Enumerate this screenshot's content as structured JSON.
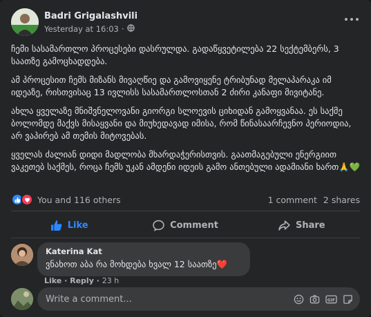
{
  "post": {
    "author": "Badri Grigalashvili",
    "time": "Yesterday at 16:03",
    "paragraphs": [
      "ჩემი სასამართლო პროცესები დასრულდა. გადაწყვეტილება 22 სექტემბერს, 3 საათზე გამოცხადდება.",
      "ამ პროცესით ჩემს მიზანს მივაღწიე და გამოვიყენე ტრიბუნად მელაპარაკა იმ იდეაზე, რისთვისაც 13 ივლისს სასამართლოსთან 2 ძირი კანაფი მივიტანე.",
      "ახლა ყველაზე მნიშვნელოვანი გიორგი სლოევის ციხიდან გამოყვანაა. ეს საქმე ბოლომდე მაქვს მისაყვანი და მიუხედავად იმისა, რომ წინასაარჩევნო პერიოდია, არ ვაპირებ ამ თემის მიტოვებას.",
      "ყველას ძალიან დიდი მადლობა  მხარდაჭერისთვის. გაათმაგებული ენერგიით ვაკეთებ საქმეს, როცა ჩემს უკან ამდენი იდეის გამო ანთებული ადამიანი ხართ🙏💚"
    ]
  },
  "reactions": {
    "summary": "You and 116 others",
    "comments": "1 comment",
    "shares": "2 shares"
  },
  "actions": {
    "like": "Like",
    "comment": "Comment",
    "share": "Share"
  },
  "comment": {
    "author": "Katerina Kat",
    "text": "ვნახოთ აბა რა მოხდება ხვალ 12 საათზე❤️",
    "like": "Like",
    "reply": "Reply",
    "time": "23 h"
  },
  "composer": {
    "placeholder": "Write a comment..."
  },
  "icons": {
    "public": "globe-icon",
    "more": "more-icon",
    "like_reaction": "like-reaction-icon",
    "love_reaction": "love-reaction-icon",
    "emoji": "emoji-icon",
    "camera": "camera-icon",
    "gif": "gif-icon",
    "sticker": "sticker-icon"
  },
  "colors": {
    "background": "#242526",
    "accent": "#2d88ff",
    "love": "#f33e58",
    "bubble": "#3a3b3c"
  }
}
